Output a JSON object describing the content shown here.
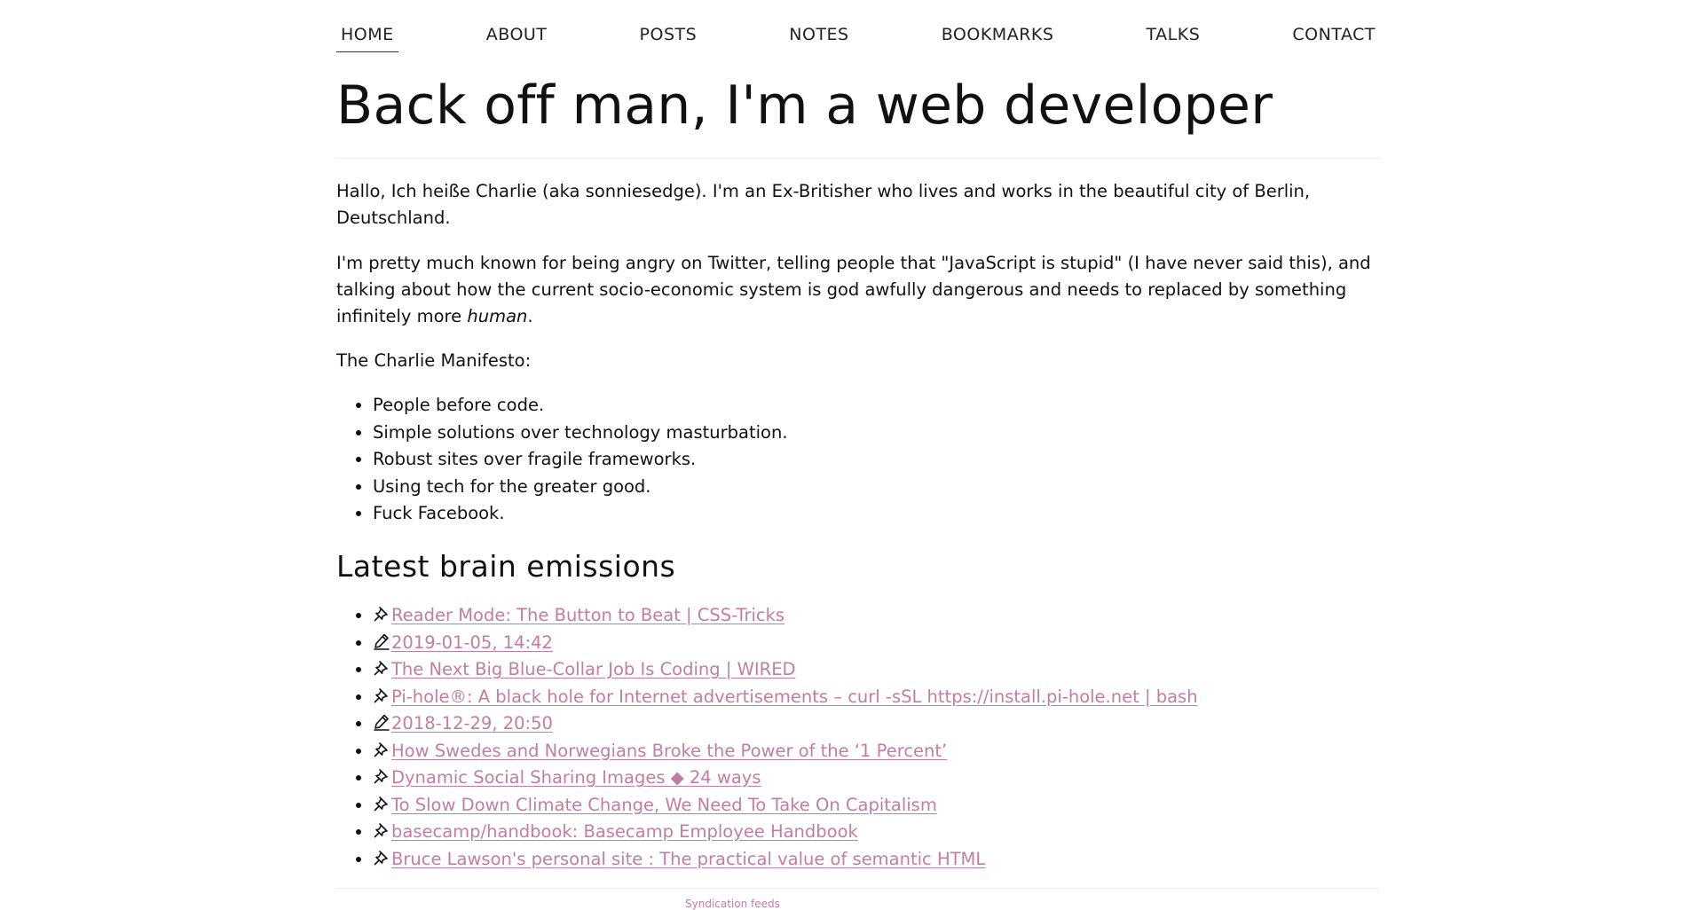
{
  "nav": {
    "items": [
      {
        "label": "HOME",
        "active": true
      },
      {
        "label": "ABOUT"
      },
      {
        "label": "POSTS"
      },
      {
        "label": "NOTES"
      },
      {
        "label": "BOOKMARKS"
      },
      {
        "label": "TALKS"
      },
      {
        "label": "CONTACT"
      }
    ]
  },
  "page": {
    "title": "Back off man, I'm a web developer",
    "intro": "Hallo, Ich heiße Charlie (aka sonniesedge). I'm an Ex-Britisher who lives and works in the beautiful city of Berlin, Deutschland.",
    "para2_main": "I'm pretty much known for being angry on Twitter, telling people that \"JavaScript is stupid\" (I have never said this), and talking about how the current socio-economic system is god awfully dangerous and needs to replaced by something infinitely more ",
    "para2_em": "human",
    "para2_end": ".",
    "manifesto_heading": "The Charlie Manifesto:",
    "manifesto": [
      "People before code.",
      "Simple solutions over technology masturbation.",
      "Robust sites over fragile frameworks.",
      "Using tech for the greater good.",
      "Fuck Facebook."
    ]
  },
  "latest": {
    "heading": "Latest brain emissions",
    "items": [
      {
        "icon": "pin-icon",
        "text": "Reader Mode: The Button to Beat | CSS-Tricks"
      },
      {
        "icon": "pencil-icon",
        "text": "2019-01-05, 14:42"
      },
      {
        "icon": "pin-icon",
        "text": "The Next Big Blue-Collar Job Is Coding | WIRED"
      },
      {
        "icon": "pin-icon",
        "text": "Pi-hole®: A black hole for Internet advertisements – curl -sSL https://install.pi-hole.net | bash"
      },
      {
        "icon": "pencil-icon",
        "text": "2018-12-29, 20:50"
      },
      {
        "icon": "pin-icon",
        "text": "How Swedes and Norwegians Broke the Power of the ‘1 Percent’"
      },
      {
        "icon": "pin-icon",
        "text": "Dynamic Social Sharing Images ◆ 24 ways"
      },
      {
        "icon": "pin-icon",
        "text": "To Slow Down Climate Change, We Need To Take On Capitalism"
      },
      {
        "icon": "pin-icon",
        "text": "basecamp/handbook: Basecamp Employee Handbook"
      },
      {
        "icon": "pin-icon",
        "text": "Bruce Lawson's personal site  : The practical value of semantic HTML"
      }
    ]
  },
  "footer": {
    "syndication": "Syndication feeds"
  },
  "colors": {
    "link": "#c27da3",
    "text": "#111111"
  }
}
